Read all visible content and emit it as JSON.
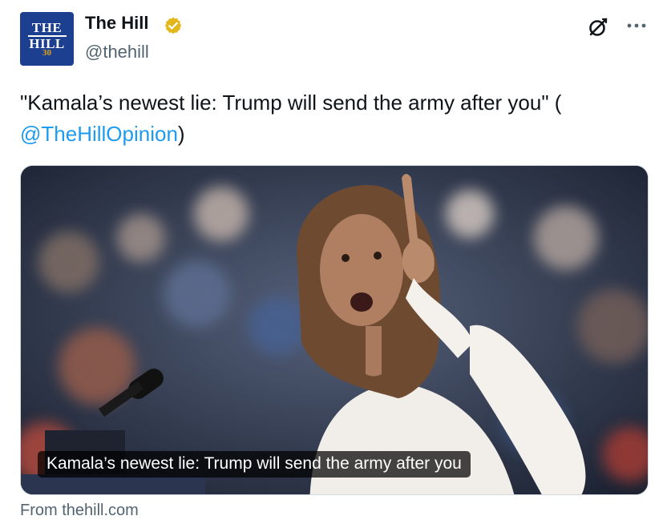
{
  "account": {
    "avatar_line1": "THE",
    "avatar_line2": "HILL",
    "avatar_years": "30",
    "display_name": "The Hill",
    "handle": "@thehill",
    "verified": true
  },
  "tweet": {
    "text_prefix": "\"Kamala’s newest lie: Trump will send the army after you\" (",
    "mention": "@TheHillOpinion",
    "text_suffix": ")"
  },
  "card": {
    "image_subject": "person-pointing-at-rally",
    "caption": "Kamala’s newest lie: Trump will send the army after you",
    "source": "From thehill.com"
  },
  "icons": {
    "verified": "verified-badge-icon",
    "grok": "grok-icon",
    "more": "more-options-icon"
  },
  "colors": {
    "link": "#1d9bf0",
    "muted": "#536471",
    "verified_gold": "#e2b719",
    "avatar_blue": "#1d3f8f"
  }
}
